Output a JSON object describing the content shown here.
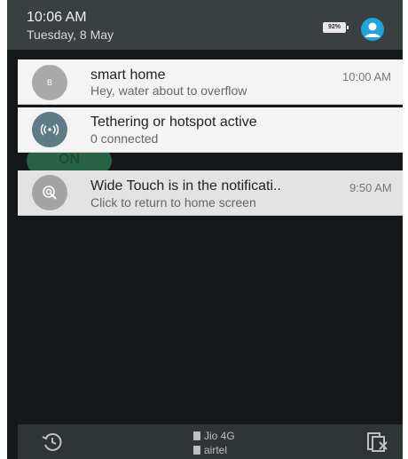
{
  "status": {
    "time": "10:06 AM",
    "date": "Tuesday, 8 May",
    "battery": "92%"
  },
  "background": {
    "toggle_label": "ON"
  },
  "notifications": [
    {
      "icon_letter": "B",
      "title": "smart home",
      "text": "Hey, water about to overflow",
      "time": "10:00 AM"
    },
    {
      "icon": "hotspot-icon",
      "title": "Tethering or hotspot active",
      "text": "0 connected"
    },
    {
      "icon": "wide-touch-icon",
      "title": "Wide Touch is in the notificati..",
      "text": "Click to return to home screen",
      "time": "9:50 AM"
    }
  ],
  "footer": {
    "carrier1": "Jio 4G",
    "carrier2": "airtel"
  },
  "colors": {
    "shade": "#14181b",
    "header": "#3a3f42",
    "avatar": "#1fa3d8",
    "icon_gray": "#9e9e9e",
    "icon_slate": "#5f7b86"
  }
}
